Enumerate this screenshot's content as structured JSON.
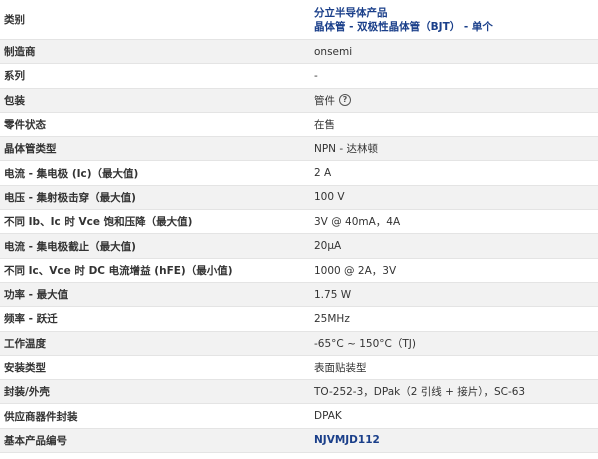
{
  "colors": {
    "link": "#1a3f8a",
    "shade": "#f2f2f2",
    "border": "#e4e4e4",
    "text": "#333333"
  },
  "category": {
    "label": "类别",
    "links": [
      "分立半导体产品",
      "晶体管 - 双极性晶体管（BJT） - 单个"
    ]
  },
  "rows": [
    {
      "label": "制造商",
      "value": "onsemi"
    },
    {
      "label": "系列",
      "value": "-"
    },
    {
      "label": "包装",
      "value": "管件",
      "icon": "help-circle-icon"
    },
    {
      "label": "零件状态",
      "value": "在售"
    },
    {
      "label": "晶体管类型",
      "value": "NPN - 达林顿"
    },
    {
      "label": "电流 - 集电极 (Ic)（最大值)",
      "value": "2 A"
    },
    {
      "label": "电压 - 集射极击穿（最大值)",
      "value": "100 V"
    },
    {
      "label": "不同 Ib、Ic 时 Vce 饱和压降（最大值)",
      "value": "3V @ 40mA，4A"
    },
    {
      "label": "电流 - 集电极截止（最大值)",
      "value": "20μA"
    },
    {
      "label": "不同 Ic、Vce 时 DC 电流增益 (hFE)（最小值)",
      "value": "1000 @ 2A，3V"
    },
    {
      "label": "功率 - 最大值",
      "value": "1.75 W"
    },
    {
      "label": "频率 - 跃迁",
      "value": "25MHz"
    },
    {
      "label": "工作温度",
      "value": "-65°C ~ 150°C（TJ)"
    },
    {
      "label": "安装类型",
      "value": "表面贴装型"
    },
    {
      "label": "封装/外壳",
      "value": "TO-252-3，DPak（2 引线 + 接片），SC-63"
    },
    {
      "label": "供应商器件封装",
      "value": "DPAK"
    },
    {
      "label": "基本产品编号",
      "value": "NJVMJD112"
    }
  ]
}
